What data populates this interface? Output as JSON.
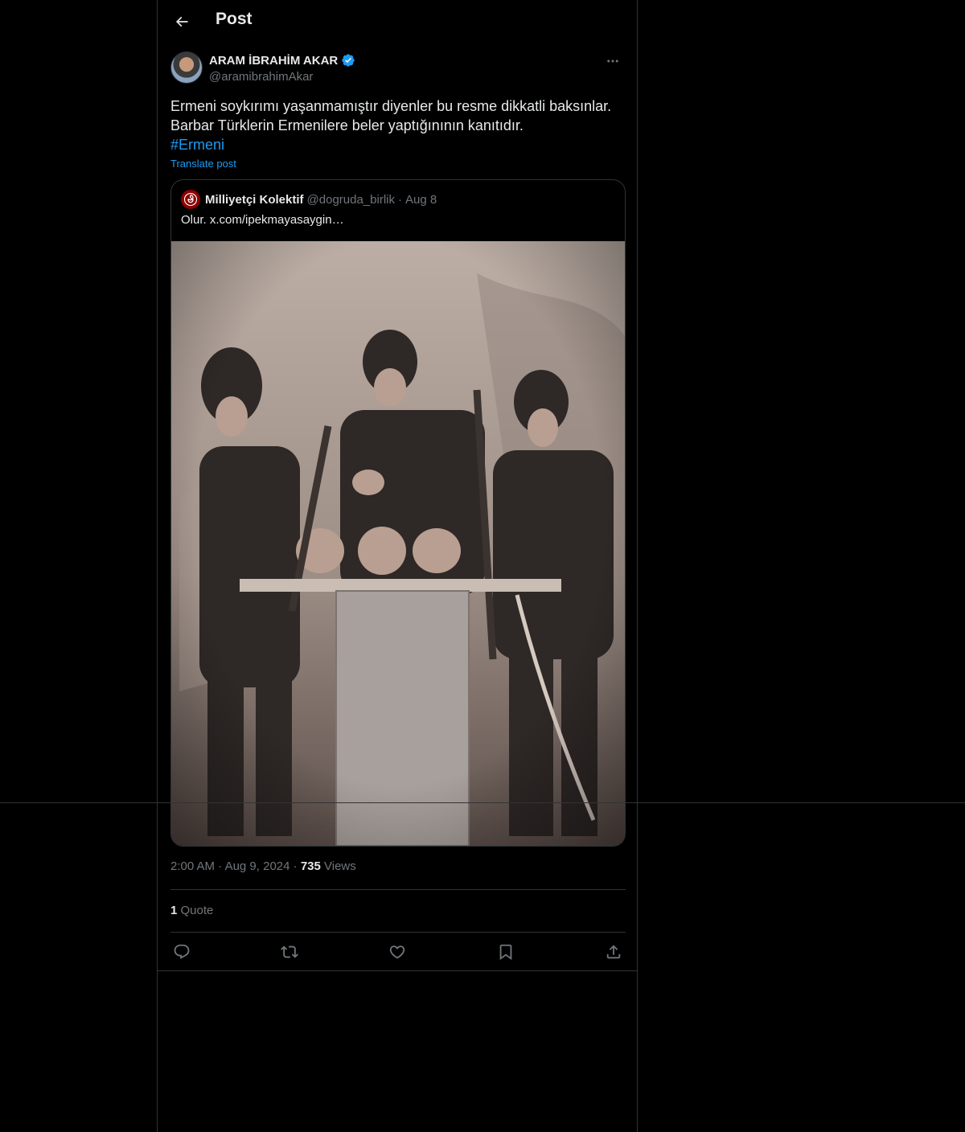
{
  "header": {
    "title": "Post"
  },
  "post": {
    "author_name": "ARAM İBRAHİM AKAR",
    "author_handle": "@aramibrahimAkar",
    "text_line1": "Ermeni soykırımı yaşanmamıştır diyenler bu resme dikkatli baksınlar.",
    "text_line2": "Barbar Türklerin Ermenilere beler yaptığınının kanıtıdır.",
    "hashtag": "#Ermeni",
    "translate_label": "Translate post",
    "time": "2:00 AM",
    "date": "Aug 9, 2024",
    "views_count": "735",
    "views_label": "Views",
    "quote_count": "1",
    "quote_label": "Quote"
  },
  "quoted": {
    "name": "Milliyetçi Kolektif",
    "handle": "@dogruda_birlik",
    "separator": "·",
    "date": "Aug 8",
    "text": "Olur.  x.com/ipekmayasaygin…"
  },
  "icons": {
    "back": "arrow-left-icon",
    "verified": "verified-badge-icon",
    "more": "more-horizontal-icon",
    "reply": "reply-icon",
    "repost": "repost-icon",
    "like": "heart-icon",
    "bookmark": "bookmark-icon",
    "share": "share-icon"
  },
  "colors": {
    "accent": "#1d9bf0",
    "background": "#000000",
    "muted": "#71767b",
    "border": "#2f3336"
  }
}
